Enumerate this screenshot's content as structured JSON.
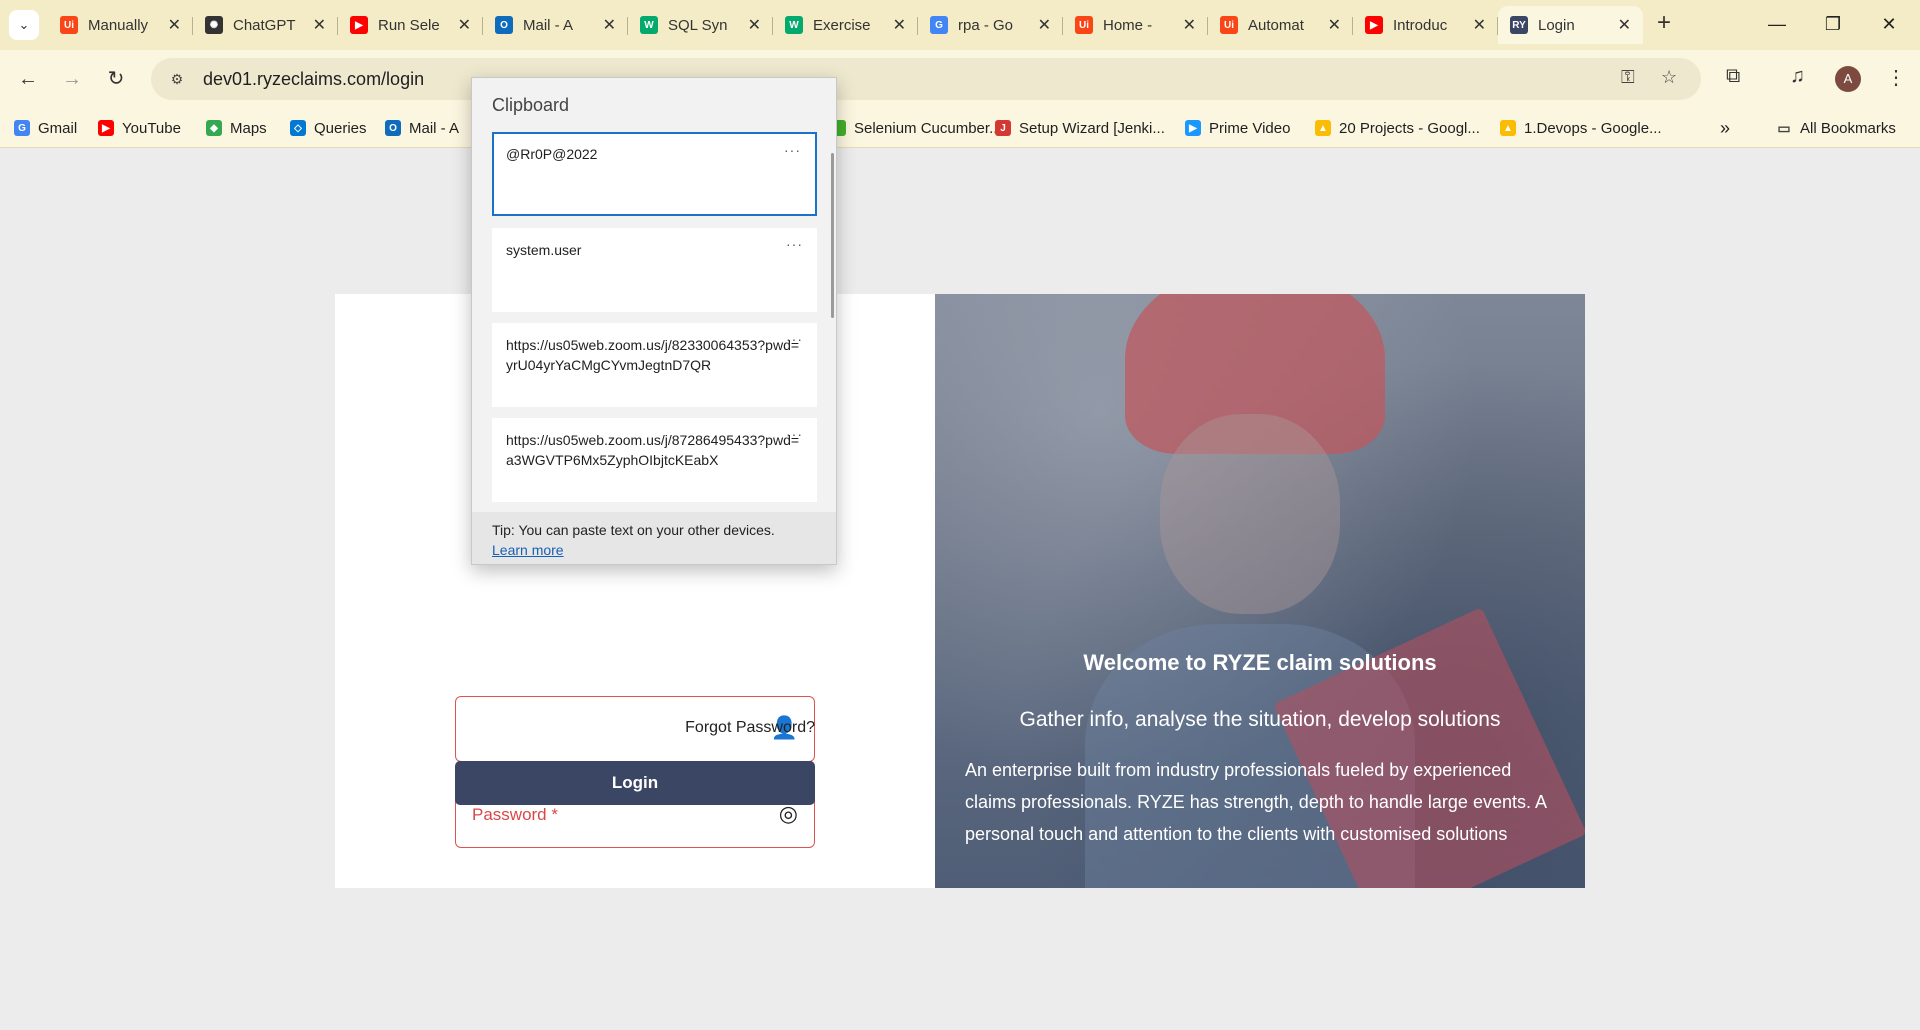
{
  "browser": {
    "tabs": [
      {
        "title": "Manually",
        "icon": "uipath-icon",
        "color": "#fa4616",
        "glyph": "Ui"
      },
      {
        "title": "ChatGPT",
        "icon": "chatgpt-icon",
        "color": "#333333",
        "glyph": "✺"
      },
      {
        "title": "Run Sele",
        "icon": "youtube-icon",
        "color": "#ff0000",
        "glyph": "▶"
      },
      {
        "title": "Mail - A",
        "icon": "outlook-icon",
        "color": "#0f6cbd",
        "glyph": "O"
      },
      {
        "title": "SQL Syn",
        "icon": "w3schools-icon",
        "color": "#04aa6d",
        "glyph": "W"
      },
      {
        "title": "Exercise",
        "icon": "w3schools-icon",
        "color": "#04aa6d",
        "glyph": "W"
      },
      {
        "title": "rpa - Go",
        "icon": "google-icon",
        "color": "#4285f4",
        "glyph": "G"
      },
      {
        "title": "Home -",
        "icon": "uipath-icon",
        "color": "#fa4616",
        "glyph": "Ui"
      },
      {
        "title": "Automat",
        "icon": "uipath-icon",
        "color": "#fa4616",
        "glyph": "Ui"
      },
      {
        "title": "Introduc",
        "icon": "youtube-icon",
        "color": "#ff0000",
        "glyph": "▶"
      },
      {
        "title": "Login",
        "icon": "ryze-icon",
        "color": "#3a4664",
        "glyph": "RY"
      }
    ],
    "url": "dev01.ryzeclaims.com/login",
    "avatar_letter": "A",
    "bookmarks": [
      {
        "label": "Gmail",
        "icon": "google-icon",
        "color": "#4285f4",
        "glyph": "G"
      },
      {
        "label": "YouTube",
        "icon": "youtube-icon",
        "color": "#ff0000",
        "glyph": "▶"
      },
      {
        "label": "Maps",
        "icon": "maps-icon",
        "color": "#34a853",
        "glyph": "◆"
      },
      {
        "label": "Queries",
        "icon": "azure-devops-icon",
        "color": "#0078d4",
        "glyph": "◇"
      },
      {
        "label": "Mail - A",
        "icon": "outlook-icon",
        "color": "#0f6cbd",
        "glyph": "O"
      },
      {
        "label": "Selenium Cucumber...",
        "icon": "selenium-icon",
        "color": "#43b02a",
        "glyph": ""
      },
      {
        "label": "Setup Wizard [Jenki...",
        "icon": "jenkins-icon",
        "color": "#d33833",
        "glyph": "J"
      },
      {
        "label": "Prime Video",
        "icon": "prime-video-icon",
        "color": "#1a98ff",
        "glyph": "▶"
      },
      {
        "label": "20 Projects - Googl...",
        "icon": "google-drive-icon",
        "color": "#fbbc04",
        "glyph": "▲"
      },
      {
        "label": "1.Devops - Google...",
        "icon": "google-drive-icon",
        "color": "#fbbc04",
        "glyph": "▲"
      }
    ],
    "all_bookmarks": "All Bookmarks"
  },
  "login": {
    "password_label": "Password *",
    "forgot": "Forgot Password?",
    "button": "Login"
  },
  "hero": {
    "title": "Welcome to RYZE claim solutions",
    "subtitle": "Gather info, analyse the situation, develop solutions",
    "text": "An enterprise built from industry professionals fueled by experienced claims professionals. RYZE has strength, depth to handle large events. A personal touch and attention to the clients with customised solutions"
  },
  "clipboard": {
    "title": "Clipboard",
    "items": [
      "@Rr0P@2022",
      "system.user",
      "https://us05web.zoom.us/j/82330064353?pwd=yrU04yrYaCMgCYvmJegtnD7QR",
      "https://us05web.zoom.us/j/87286495433?pwd=a3WGVTP6Mx5ZyphOIbjtcKEabX"
    ],
    "more": "···",
    "tip": "Tip: You can paste text on your other devices.",
    "learn_more": "Learn more"
  }
}
